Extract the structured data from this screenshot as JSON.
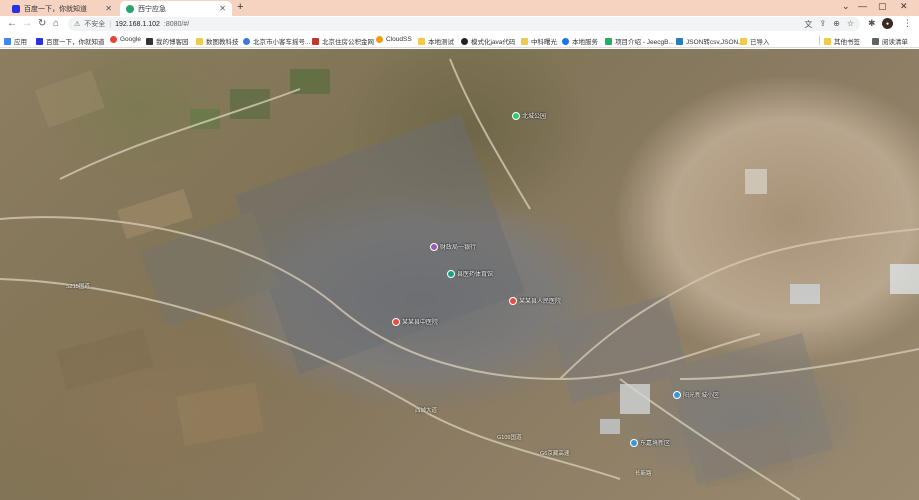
{
  "browser": {
    "tabs": [
      {
        "label": "百度一下，你就知道",
        "active": false,
        "icon": "baidu-paw-icon"
      },
      {
        "label": "西宁应急",
        "active": true,
        "icon": "site-leaf-icon"
      }
    ],
    "new_tab_label": "+",
    "window_controls": [
      "⌄",
      "—",
      "▢",
      "✕"
    ],
    "address": {
      "security_label": "不安全",
      "host": "192.168.1.102",
      "path": ":8080/#/"
    },
    "bookmarks": [
      {
        "label": "应用",
        "icon": "apps-grid-icon",
        "color": "#4285f4"
      },
      {
        "label": "百度一下，你就知道",
        "icon": "baidu-paw-icon",
        "color": "#2932e1"
      },
      {
        "label": "Google",
        "icon": "google-g-icon",
        "color": "#ea4335"
      },
      {
        "label": "我的博客园",
        "icon": "blog-icon",
        "color": "#333333"
      },
      {
        "label": "数图教科技",
        "icon": "folder-icon",
        "color": "#f2c94c"
      },
      {
        "label": "北京市小客车摇号...",
        "icon": "lottery-icon",
        "color": "#3a7bd5"
      },
      {
        "label": "北京住房公积金网",
        "icon": "fund-icon",
        "color": "#c0392b"
      },
      {
        "label": "CloudSS",
        "icon": "cloud-icon",
        "color": "#f39c12"
      },
      {
        "label": "本地测试",
        "icon": "folder-icon",
        "color": "#f2c94c"
      },
      {
        "label": "模式化java代码",
        "icon": "github-icon",
        "color": "#222222"
      },
      {
        "label": "中科曙光",
        "icon": "folder-icon",
        "color": "#f2c94c"
      },
      {
        "label": "本地服务",
        "icon": "cloud-icon",
        "color": "#1a73e8"
      },
      {
        "label": "项目介绍 - JeecgB...",
        "icon": "jeecg-icon",
        "color": "#27ae60"
      },
      {
        "label": "JSON转csv,JSON...",
        "icon": "json-icon",
        "color": "#2980b9"
      },
      {
        "label": "已导入",
        "icon": "folder-icon",
        "color": "#f2c94c"
      }
    ],
    "bookmarks_other": "其他书签",
    "bookmarks_reading": "阅读清单"
  },
  "map": {
    "type": "satellite",
    "pois": [
      {
        "label": "北城公园",
        "color": "#2ecc71"
      },
      {
        "label": "财政局一银行",
        "color": "#9b59b6"
      },
      {
        "label": "县医药体育馆",
        "color": "#16a085"
      },
      {
        "label": "某某县人民医院",
        "color": "#e74c3c"
      },
      {
        "label": "某某县中医院",
        "color": "#e74c3c"
      },
      {
        "label": "阳光新城小区",
        "color": "#3498db"
      },
      {
        "label": "东嘉境新区",
        "color": "#3498db"
      }
    ],
    "roads": [
      {
        "label": "S215国道"
      },
      {
        "label": "西城大道"
      },
      {
        "label": "G109国道"
      },
      {
        "label": "G6京藏高速"
      },
      {
        "label": "长新路"
      }
    ]
  }
}
